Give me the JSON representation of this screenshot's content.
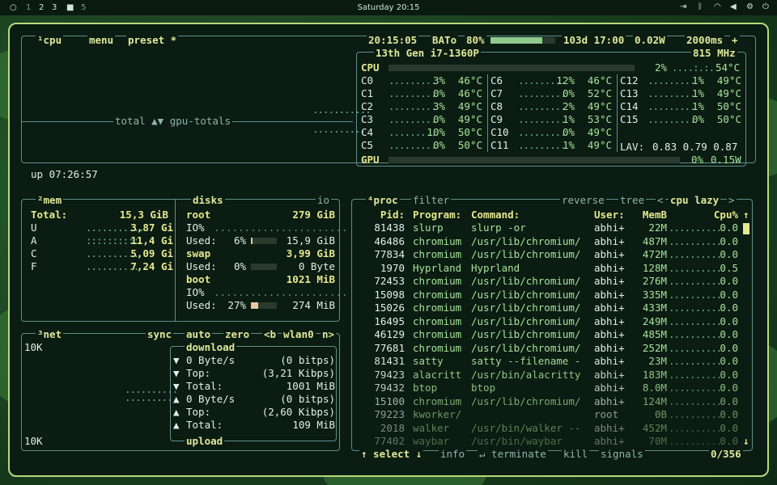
{
  "topbar": {
    "workspaces": [
      "1",
      "2",
      "3",
      "4",
      "5"
    ],
    "clock": "Saturday 20:15"
  },
  "cpu_box": {
    "tabs": [
      "¹cpu",
      "menu",
      "preset *"
    ],
    "time": "20:15:05",
    "battery_label": "BATo",
    "battery_pct": "80%",
    "battery_level": 0.8,
    "battery_time": "103d 17:00",
    "power": "0.02W",
    "interval": "2000ms",
    "graph_label": "total ▲▼ gpu-totals",
    "uptime": "up 07:26:57",
    "cpu_model": "13th Gen i7-1360P",
    "freq": "815 MHz",
    "cpu_total_label": "CPU",
    "cpu_total_pct": "2%",
    "cpu_total_temp": "54°C",
    "cores": [
      {
        "name": "C0",
        "pct": "3%",
        "temp": "46°C"
      },
      {
        "name": "C1",
        "pct": "0%",
        "temp": "46°C"
      },
      {
        "name": "C2",
        "pct": "3%",
        "temp": "49°C"
      },
      {
        "name": "C3",
        "pct": "0%",
        "temp": "49°C"
      },
      {
        "name": "C4",
        "pct": "10%",
        "temp": "50°C"
      },
      {
        "name": "C5",
        "pct": "0%",
        "temp": "50°C"
      },
      {
        "name": "C6",
        "pct": "12%",
        "temp": "46°C"
      },
      {
        "name": "C7",
        "pct": "0%",
        "temp": "52°C"
      },
      {
        "name": "C8",
        "pct": "2%",
        "temp": "49°C"
      },
      {
        "name": "C9",
        "pct": "1%",
        "temp": "53°C"
      },
      {
        "name": "C10",
        "pct": "0%",
        "temp": "49°C"
      },
      {
        "name": "C11",
        "pct": "1%",
        "temp": "49°C"
      },
      {
        "name": "C12",
        "pct": "1%",
        "temp": "49°C"
      },
      {
        "name": "C13",
        "pct": "1%",
        "temp": "49°C"
      },
      {
        "name": "C14",
        "pct": "1%",
        "temp": "50°C"
      },
      {
        "name": "C15",
        "pct": "0%",
        "temp": "50°C"
      }
    ],
    "lav_label": "LAV:",
    "lav": "0.83 0.79 0.87",
    "gpu_label": "GPU",
    "gpu_pct": "0%",
    "gpu_power": "0.15W"
  },
  "mem_box": {
    "title": "²mem",
    "total_label": "Total:",
    "total": "15,3 GiB",
    "rows": [
      {
        "label": "U",
        "value": "3,87 Gi"
      },
      {
        "label": "A",
        "value": "11,4 Gi"
      },
      {
        "label": "C",
        "value": "5,09 Gi"
      },
      {
        "label": "F",
        "value": "7,24 Gi"
      }
    ]
  },
  "disks_box": {
    "title": "disks",
    "io_title": "io",
    "disks": [
      {
        "name": "root",
        "size": "279 GiB",
        "io": "IO%",
        "used_label": "Used:",
        "used_pct": "6%",
        "used": "15,9 GiB",
        "level": 0.06
      },
      {
        "name": "swap",
        "size": "3,99 GiB",
        "io": "",
        "used_label": "Used:",
        "used_pct": "0%",
        "used": "0 Byte",
        "level": 0.0
      },
      {
        "name": "boot",
        "size": "1021 MiB",
        "io": "IO%",
        "used_label": "Used:",
        "used_pct": "27%",
        "used": "274 MiB",
        "level": 0.27
      }
    ]
  },
  "net_box": {
    "title": "³net",
    "tabs": [
      "sync",
      "auto",
      "zero",
      "<b",
      "wlan0",
      "n>"
    ],
    "scale_top": "10K",
    "scale_bottom": "10K",
    "download_label": "download",
    "upload_label": "upload",
    "down": [
      {
        "arrow": "▼",
        "label": "0 Byte/s",
        "value": "(0 bitps)"
      },
      {
        "arrow": "▼",
        "label": "Top:",
        "value": "(3,21 Kibps)"
      },
      {
        "arrow": "▼",
        "label": "Total:",
        "value": "1001 MiB"
      }
    ],
    "up": [
      {
        "arrow": "▲",
        "label": "0 Byte/s",
        "value": "(0 bitps)"
      },
      {
        "arrow": "▲",
        "label": "Top:",
        "value": "(2,60 Kibps)"
      },
      {
        "arrow": "▲",
        "label": "Total:",
        "value": "109 MiB"
      }
    ]
  },
  "proc_box": {
    "title": "⁴proc",
    "tabs": [
      "filter",
      "reverse",
      "tree",
      "<",
      "cpu lazy",
      ">"
    ],
    "headers": {
      "pid": "Pid:",
      "program": "Program:",
      "command": "Command:",
      "user": "User:",
      "mem": "MemB",
      "cpu": "Cpu%"
    },
    "rows": [
      {
        "pid": "81438",
        "program": "slurp",
        "command": "slurp -or",
        "user": "abhi+",
        "mem": "22M",
        "cpu": "0.0"
      },
      {
        "pid": "46486",
        "program": "chromium",
        "command": "/usr/lib/chromium/",
        "user": "abhi+",
        "mem": "487M",
        "cpu": "0.0"
      },
      {
        "pid": "77834",
        "program": "chromium",
        "command": "/usr/lib/chromium/",
        "user": "abhi+",
        "mem": "472M",
        "cpu": "0.0"
      },
      {
        "pid": "1970",
        "program": "Hyprland",
        "command": "Hyprland",
        "user": "abhi+",
        "mem": "128M",
        "cpu": "0.5"
      },
      {
        "pid": "72453",
        "program": "chromium",
        "command": "/usr/lib/chromium/",
        "user": "abhi+",
        "mem": "276M",
        "cpu": "0.0"
      },
      {
        "pid": "15098",
        "program": "chromium",
        "command": "/usr/lib/chromium/",
        "user": "abhi+",
        "mem": "335M",
        "cpu": "0.0"
      },
      {
        "pid": "15026",
        "program": "chromium",
        "command": "/usr/lib/chromium/",
        "user": "abhi+",
        "mem": "433M",
        "cpu": "0.0"
      },
      {
        "pid": "16495",
        "program": "chromium",
        "command": "/usr/lib/chromium/",
        "user": "abhi+",
        "mem": "249M",
        "cpu": "0.0"
      },
      {
        "pid": "46129",
        "program": "chromium",
        "command": "/usr/lib/chromium/",
        "user": "abhi+",
        "mem": "485M",
        "cpu": "0.0"
      },
      {
        "pid": "77681",
        "program": "chromium",
        "command": "/usr/lib/chromium/",
        "user": "abhi+",
        "mem": "252M",
        "cpu": "0.0"
      },
      {
        "pid": "81431",
        "program": "satty",
        "command": "satty --filename -",
        "user": "abhi+",
        "mem": "23M",
        "cpu": "0.0"
      },
      {
        "pid": "79423",
        "program": "alacritt",
        "command": "/usr/bin/alacritty",
        "user": "abhi+",
        "mem": "183M",
        "cpu": "0.0"
      },
      {
        "pid": "79432",
        "program": "btop",
        "command": "btop",
        "user": "abhi+",
        "mem": "8.0M",
        "cpu": "0.0"
      },
      {
        "pid": "15100",
        "program": "chromium",
        "command": "/usr/lib/chromium/",
        "user": "abhi+",
        "mem": "124M",
        "cpu": "0.0"
      },
      {
        "pid": "79223",
        "program": "kworker/",
        "command": "",
        "user": "root",
        "mem": "0B",
        "cpu": "0.0"
      },
      {
        "pid": "2018",
        "program": "walker",
        "command": "/usr/bin/walker --",
        "user": "abhi+",
        "mem": "452M",
        "cpu": "0.0"
      },
      {
        "pid": "77402",
        "program": "waybar",
        "command": "/usr/bin/waybar",
        "user": "abhi+",
        "mem": "70M",
        "cpu": "0.0"
      }
    ],
    "footer": {
      "select": "↑ select ↓",
      "info": "info",
      "terminate": "↵ terminate",
      "kill": "kill",
      "signals": "signals",
      "count": "0/356"
    }
  }
}
